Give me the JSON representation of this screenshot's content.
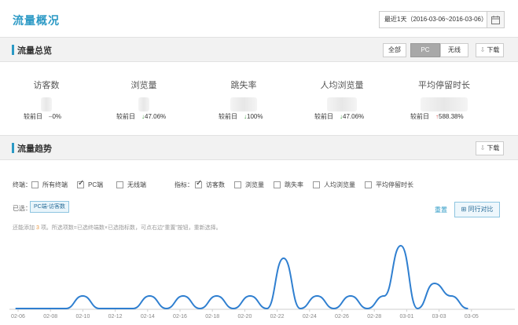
{
  "header": {
    "title": "流量概况",
    "date_range": "最近1天（2016-03-06~2016-03-06）"
  },
  "overview": {
    "title": "流量总览",
    "terminal_tabs": [
      "全部",
      "PC",
      "无线"
    ],
    "active_tab": "PC",
    "download_label": "下载",
    "compare_label": "较前日",
    "metrics": [
      {
        "label": "访客数",
        "change": "0%",
        "direction": "flat"
      },
      {
        "label": "浏览量",
        "change": "47.06%",
        "direction": "down"
      },
      {
        "label": "跳失率",
        "change": "100%",
        "direction": "down"
      },
      {
        "label": "人均浏览量",
        "change": "47.06%",
        "direction": "down"
      },
      {
        "label": "平均停留时长",
        "change": "588.38%",
        "direction": "up"
      }
    ]
  },
  "trend": {
    "title": "流量趋势",
    "download_label": "下载",
    "terminal_label": "终端：",
    "terminals": [
      {
        "label": "所有终端",
        "checked": false
      },
      {
        "label": "PC端",
        "checked": true
      },
      {
        "label": "无线端",
        "checked": false
      }
    ],
    "indicator_label": "指标：",
    "indicators": [
      {
        "label": "访客数",
        "checked": true
      },
      {
        "label": "浏览量",
        "checked": false
      },
      {
        "label": "跳失率",
        "checked": false
      },
      {
        "label": "人均浏览量",
        "checked": false
      },
      {
        "label": "平均停留时长",
        "checked": false
      }
    ],
    "chosen_label": "已选：",
    "chosen_tag": "PC端-访客数",
    "reset_label": "重置",
    "compare_label": "同行对比",
    "hint_prefix": "还能添加",
    "hint_count": "3",
    "hint_suffix": "项。所选项数=已选终端数×已选指标数，可点右边“重置”按钮，重新选择。"
  },
  "colors": {
    "accent": "#2b99c5",
    "line": "#2f7fd0",
    "up": "#d9534f",
    "down": "#3a9a3a"
  },
  "chart_data": {
    "type": "line",
    "x": [
      "02-06",
      "02-07",
      "02-08",
      "02-09",
      "02-10",
      "02-11",
      "02-12",
      "02-13",
      "02-14",
      "02-15",
      "02-16",
      "02-17",
      "02-18",
      "02-19",
      "02-20",
      "02-21",
      "02-22",
      "02-23",
      "02-24",
      "02-25",
      "02-26",
      "02-27",
      "02-28",
      "02-29",
      "03-01",
      "03-02",
      "03-03",
      "03-04"
    ],
    "x_tick_labels": [
      "02-06",
      "02-08",
      "02-10",
      "02-12",
      "02-14",
      "02-16",
      "02-18",
      "02-20",
      "02-22",
      "02-24",
      "02-26",
      "02-28",
      "03-01",
      "03-03",
      "03-05"
    ],
    "series": [
      {
        "values": [
          0,
          0,
          0,
          0,
          1,
          0,
          0,
          0,
          1,
          0,
          1,
          0,
          1,
          0,
          1,
          0,
          4,
          0,
          1,
          0,
          1,
          0,
          1,
          5,
          0,
          2,
          1,
          0
        ]
      }
    ]
  }
}
